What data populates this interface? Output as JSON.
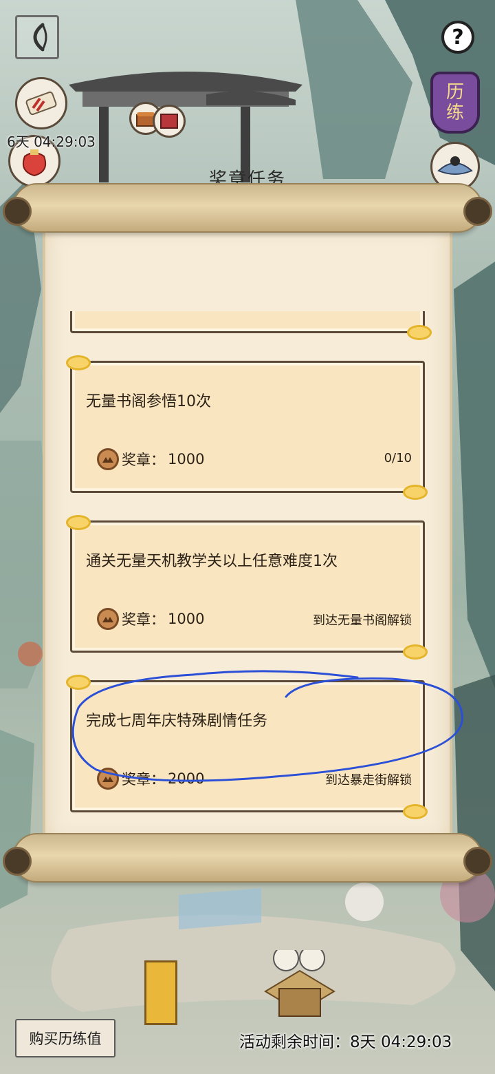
{
  "header": {
    "top_timer": "6天 04:29:03",
    "help_symbol": "?",
    "liliang_badge": "历\n练"
  },
  "panel": {
    "title": "奖章任务"
  },
  "tasks": [
    {
      "title": "无量书阁参悟10次",
      "reward_label": "奖章：",
      "reward_value": "1000",
      "status": "0/10"
    },
    {
      "title": "通关无量天机教学关以上任意难度1次",
      "reward_label": "奖章：",
      "reward_value": "1000",
      "status": "到达无量书阁解锁"
    },
    {
      "title": "完成七周年庆特殊剧情任务",
      "reward_label": "奖章：",
      "reward_value": "2000",
      "status": "到达暴走街解锁"
    }
  ],
  "footer": {
    "buy_button_label": "购买历练值",
    "activity_timer": "活动剩余时间：8天 04:29:03"
  },
  "colors": {
    "card_bg": "#f9e6c1",
    "card_border": "#5b4a38",
    "paper_bg": "#f6ecd8",
    "scroll_roll": "#cdb88f",
    "annotation_blue": "#2b4fd6"
  },
  "icons": [
    "back-icon",
    "help-icon",
    "scroll-gift-icon",
    "red-bag-icon",
    "liliang-badge-icon",
    "hat-icon",
    "medal-icon"
  ]
}
